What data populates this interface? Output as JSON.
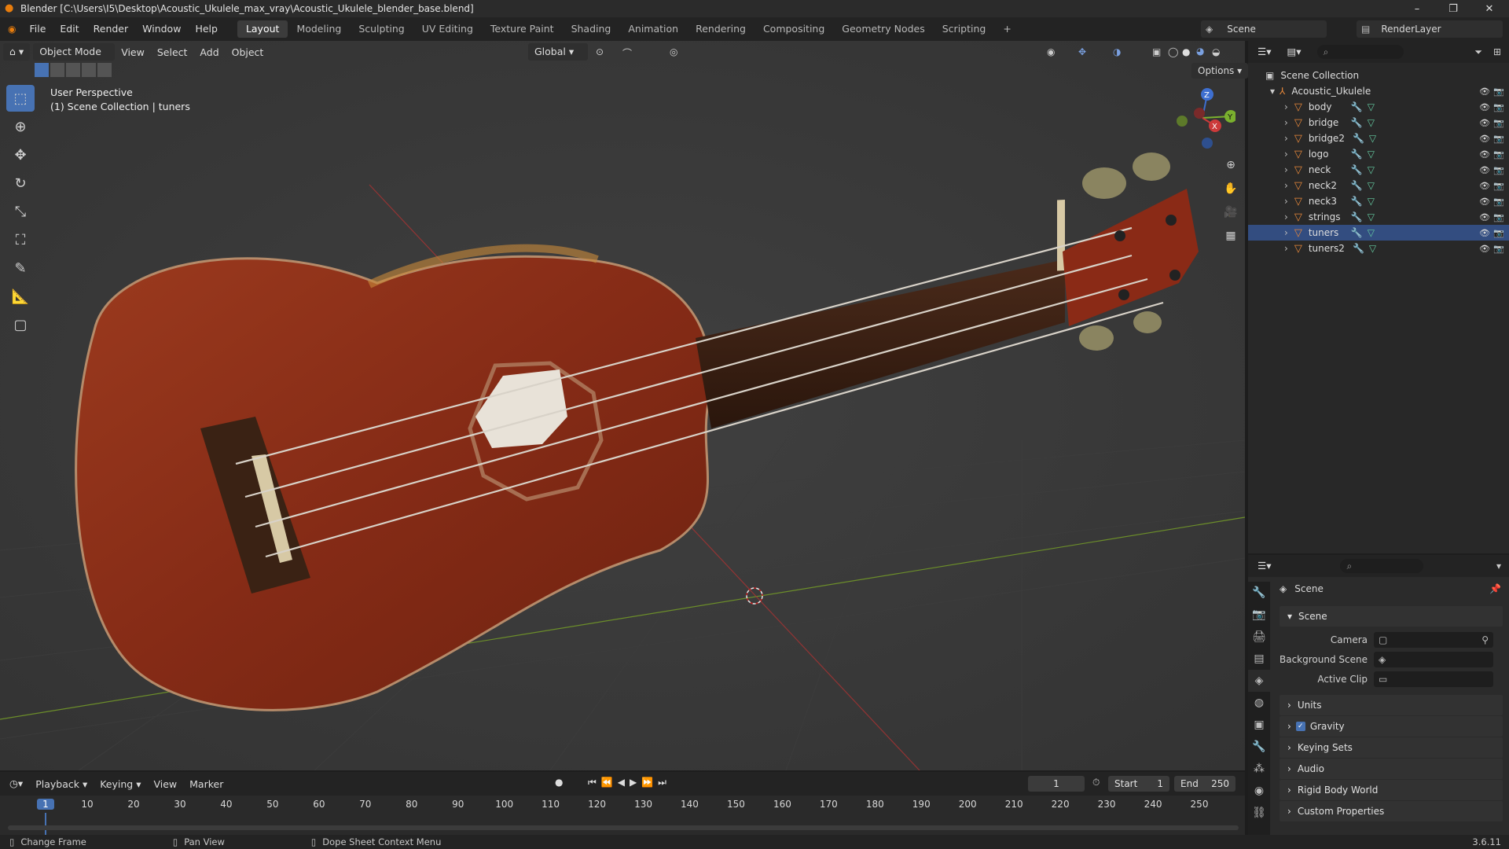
{
  "window": {
    "title": "Blender [C:\\Users\\I5\\Desktop\\Acoustic_Ukulele_max_vray\\Acoustic_Ukulele_blender_base.blend]",
    "min": "–",
    "max": "❐",
    "close": "✕"
  },
  "menus": [
    "File",
    "Edit",
    "Render",
    "Window",
    "Help"
  ],
  "workspaces": [
    "Layout",
    "Modeling",
    "Sculpting",
    "UV Editing",
    "Texture Paint",
    "Shading",
    "Animation",
    "Rendering",
    "Compositing",
    "Geometry Nodes",
    "Scripting"
  ],
  "active_workspace": "Layout",
  "add_workspace": "+",
  "scene_field": "Scene",
  "renderlayer_field": "RenderLayer",
  "viewport": {
    "mode": "Object Mode",
    "menus": [
      "View",
      "Select",
      "Add",
      "Object"
    ],
    "orientation": "Global",
    "options": "Options",
    "overlay_line1": "User Perspective",
    "overlay_line2": "(1) Scene Collection | tuners",
    "gizmo": {
      "z": "Z",
      "y": "Y",
      "x": "X"
    }
  },
  "outliner": {
    "root": "Scene Collection",
    "collection": "Acoustic_Ukulele",
    "items": [
      "body",
      "bridge",
      "bridge2",
      "logo",
      "neck",
      "neck2",
      "neck3",
      "strings",
      "tuners",
      "tuners2"
    ],
    "selected": "tuners"
  },
  "properties": {
    "header": "Scene",
    "section": "Scene",
    "fields": [
      {
        "label": "Camera",
        "value": ""
      },
      {
        "label": "Background Scene",
        "value": ""
      },
      {
        "label": "Active Clip",
        "value": ""
      }
    ],
    "panels": [
      "Units",
      "Gravity",
      "Keying Sets",
      "Audio",
      "Rigid Body World",
      "Custom Properties"
    ],
    "gravity_checked": true
  },
  "timeline": {
    "menus": [
      "Playback",
      "Keying",
      "View",
      "Marker"
    ],
    "current_frame": "1",
    "start_label": "Start",
    "start": "1",
    "end_label": "End",
    "end": "250",
    "ticks": [
      "1",
      "10",
      "20",
      "30",
      "40",
      "50",
      "60",
      "70",
      "80",
      "90",
      "100",
      "110",
      "120",
      "130",
      "140",
      "150",
      "160",
      "170",
      "180",
      "190",
      "200",
      "210",
      "220",
      "230",
      "240",
      "250"
    ]
  },
  "status": {
    "items": [
      "Change Frame",
      "Pan View",
      "Dope Sheet Context Menu"
    ],
    "version": "3.6.11"
  },
  "colors": {
    "accent": "#4772b3",
    "selected_row": "#334d80",
    "body_wood": "#8a2e18"
  }
}
